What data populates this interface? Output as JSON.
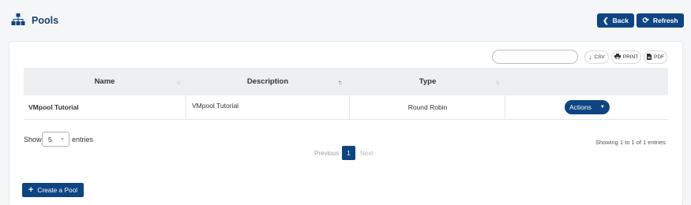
{
  "header": {
    "title": "Pools",
    "icon": "sitemap-icon",
    "back_label": "Back",
    "refresh_label": "Refresh"
  },
  "toolbar": {
    "search_value": "",
    "csv_label": "CSV",
    "print_label": "PRINT",
    "pdf_label": "PDF"
  },
  "table": {
    "columns": [
      "Name",
      "Description",
      "Type"
    ],
    "sorted_column": "Description",
    "rows": [
      {
        "name": "VMpool Tutorial",
        "description": "VMpool Tutorial",
        "type": "Round Robin",
        "actions_label": "Actions"
      }
    ]
  },
  "pagination": {
    "show_label": "Show",
    "entries_value": "5",
    "entries_label": "entries",
    "info": "Showing 1 to 1 of 1 entries",
    "prev_label": "Previous",
    "current_page": "1",
    "next_label": "Next"
  },
  "footer": {
    "create_label": "Create a Pool"
  },
  "colors": {
    "primary": "#0f4482",
    "title": "#1c3f6e",
    "header_bg": "#eeeff1",
    "page_bg": "#f5f6f8"
  }
}
